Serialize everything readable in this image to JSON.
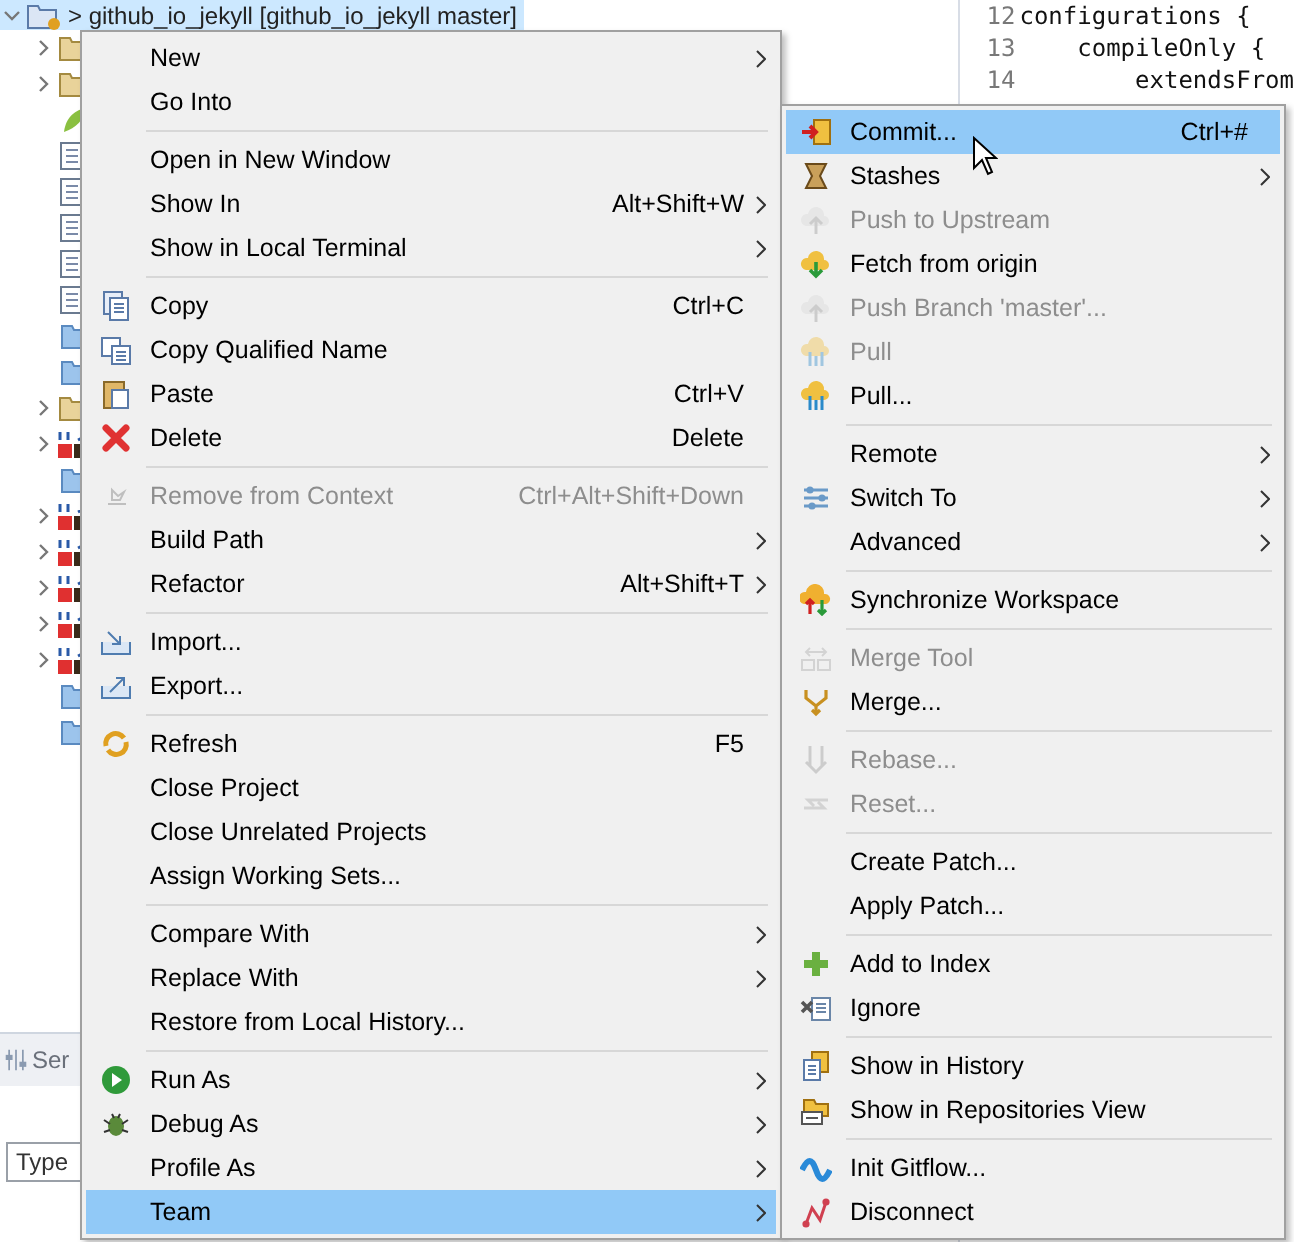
{
  "tree": {
    "selected_row": {
      "label": "> github_io_jekyll [github_io_jekyll master]",
      "selected": true
    }
  },
  "editor": {
    "lines": [
      {
        "number": "12",
        "code": "configurations {"
      },
      {
        "number": "13",
        "code": "    compileOnly {"
      },
      {
        "number": "14",
        "code": "        extendsFrom"
      }
    ]
  },
  "bottom_panel": {
    "tab": "Ser",
    "filter": {
      "placeholder": "Type"
    }
  },
  "context_menu": {
    "groups": [
      [
        {
          "label": "New",
          "submenu": true,
          "selected": false
        },
        {
          "label": "Go Into",
          "selected": false
        }
      ],
      [
        {
          "label": "Open in New Window",
          "selected": false
        },
        {
          "label": "Show In",
          "shortcut": "Alt+Shift+W",
          "submenu": true,
          "selected": false
        },
        {
          "label": "Show in Local Terminal",
          "submenu": true,
          "selected": false
        }
      ],
      [
        {
          "label": "Copy",
          "shortcut": "Ctrl+C",
          "selected": false
        },
        {
          "label": "Copy Qualified Name",
          "selected": false
        },
        {
          "label": "Paste",
          "shortcut": "Ctrl+V",
          "selected": false
        },
        {
          "label": "Delete",
          "shortcut": "Delete",
          "selected": false
        }
      ],
      [
        {
          "label": "Remove from Context",
          "shortcut": "Ctrl+Alt+Shift+Down",
          "disabled": true,
          "selected": false
        },
        {
          "label": "Build Path",
          "submenu": true,
          "selected": false
        },
        {
          "label": "Refactor",
          "shortcut": "Alt+Shift+T",
          "submenu": true,
          "selected": false
        }
      ],
      [
        {
          "label": "Import...",
          "selected": false
        },
        {
          "label": "Export...",
          "selected": false
        }
      ],
      [
        {
          "label": "Refresh",
          "shortcut": "F5",
          "selected": false
        },
        {
          "label": "Close Project",
          "selected": false
        },
        {
          "label": "Close Unrelated Projects",
          "selected": false
        },
        {
          "label": "Assign Working Sets...",
          "selected": false
        }
      ],
      [
        {
          "label": "Compare With",
          "submenu": true,
          "selected": false
        },
        {
          "label": "Replace With",
          "submenu": true,
          "selected": false
        },
        {
          "label": "Restore from Local History...",
          "selected": false
        }
      ],
      [
        {
          "label": "Run As",
          "submenu": true,
          "selected": false
        },
        {
          "label": "Debug As",
          "submenu": true,
          "selected": false
        },
        {
          "label": "Profile As",
          "submenu": true,
          "selected": false
        },
        {
          "label": "Team",
          "submenu": true,
          "selected": true
        }
      ]
    ]
  },
  "team_submenu": {
    "groups": [
      [
        {
          "label": "Commit...",
          "shortcut": "Ctrl+#",
          "selected": true
        },
        {
          "label": "Stashes",
          "submenu": true,
          "selected": false
        },
        {
          "label": "Push to Upstream",
          "disabled": true,
          "selected": false
        },
        {
          "label": "Fetch from origin",
          "selected": false
        },
        {
          "label": "Push Branch 'master'...",
          "disabled": true,
          "selected": false
        },
        {
          "label": "Pull",
          "disabled": true,
          "selected": false
        },
        {
          "label": "Pull...",
          "selected": false
        }
      ],
      [
        {
          "label": "Remote",
          "submenu": true,
          "selected": false
        },
        {
          "label": "Switch To",
          "submenu": true,
          "selected": false
        },
        {
          "label": "Advanced",
          "submenu": true,
          "selected": false
        }
      ],
      [
        {
          "label": "Synchronize Workspace",
          "selected": false
        }
      ],
      [
        {
          "label": "Merge Tool",
          "disabled": true,
          "selected": false
        },
        {
          "label": "Merge...",
          "selected": false
        }
      ],
      [
        {
          "label": "Rebase...",
          "disabled": true,
          "selected": false
        },
        {
          "label": "Reset...",
          "disabled": true,
          "selected": false
        }
      ],
      [
        {
          "label": "Create Patch...",
          "selected": false
        },
        {
          "label": "Apply Patch...",
          "selected": false
        }
      ],
      [
        {
          "label": "Add to Index",
          "selected": false
        },
        {
          "label": "Ignore",
          "selected": false
        }
      ],
      [
        {
          "label": "Show in History",
          "selected": false
        },
        {
          "label": "Show in Repositories View",
          "selected": false
        }
      ],
      [
        {
          "label": "Init Gitflow...",
          "selected": false
        },
        {
          "label": "Disconnect",
          "selected": false
        }
      ]
    ]
  }
}
